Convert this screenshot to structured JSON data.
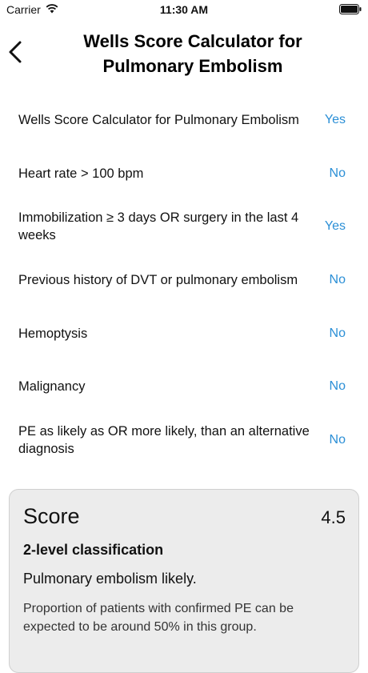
{
  "status_bar": {
    "carrier": "Carrier",
    "time": "11:30 AM"
  },
  "header": {
    "title": "Wells Score Calculator for Pulmonary Embolism"
  },
  "criteria": [
    {
      "label": "Wells Score Calculator for Pulmonary Embolism",
      "value": "Yes"
    },
    {
      "label": "Heart rate > 100 bpm",
      "value": "No"
    },
    {
      "label": "Immobilization ≥ 3 days OR surgery in the last 4 weeks",
      "value": "Yes"
    },
    {
      "label": "Previous history of DVT or pulmonary embolism",
      "value": "No"
    },
    {
      "label": "Hemoptysis",
      "value": "No"
    },
    {
      "label": "Malignancy",
      "value": "No"
    },
    {
      "label": "PE as likely as OR more likely, than an alternative diagnosis",
      "value": "No"
    }
  ],
  "result": {
    "title": "Score",
    "score": "4.5",
    "classification": "2-level classification",
    "interpretation": "Pulmonary embolism likely.",
    "description": "Proportion of patients with confirmed PE can be expected to be around 50% in this group."
  },
  "colors": {
    "accent": "#2b8fd6",
    "card_background": "#ececec"
  }
}
